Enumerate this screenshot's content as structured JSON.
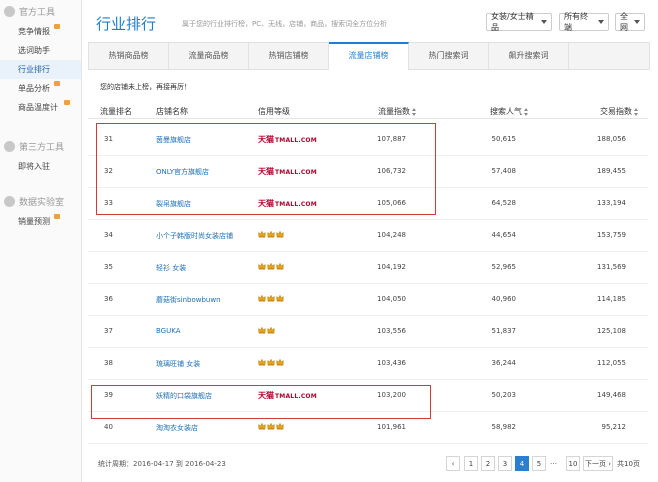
{
  "sidebar": {
    "sections": [
      {
        "title": "官方工具",
        "items": [
          {
            "label": "竞争情报",
            "flag": true
          },
          {
            "label": "选词助手",
            "flag": false
          },
          {
            "label": "行业排行",
            "flag": false,
            "active": true
          },
          {
            "label": "单品分析",
            "flag": true
          },
          {
            "label": "商品温度计",
            "flag": true
          }
        ]
      },
      {
        "title": "第三方工具",
        "items": [
          {
            "label": "即将入驻",
            "flag": false
          }
        ]
      },
      {
        "title": "数据实验室",
        "items": [
          {
            "label": "销量预测",
            "flag": true
          }
        ]
      }
    ]
  },
  "header": {
    "title": "行业排行",
    "desc": "属于您的行业排行榜，PC、无线，店铺，商品，搜索词全方位分析",
    "filters": [
      {
        "label": "女装/女士精品"
      },
      {
        "label": "所有终端"
      },
      {
        "label": "全网"
      }
    ]
  },
  "tabs": [
    {
      "label": "热销商品榜",
      "active": false
    },
    {
      "label": "流量商品榜",
      "active": false
    },
    {
      "label": "热销店铺榜",
      "active": false
    },
    {
      "label": "流量店铺榜",
      "active": true
    },
    {
      "label": "热门搜索词",
      "active": false
    },
    {
      "label": "飙升搜索词",
      "active": false
    }
  ],
  "notice": "您的店铺未上榜，再接再厉！",
  "table": {
    "columns": [
      "流量排名",
      "店铺名称",
      "信用等级",
      "流量指数",
      "搜索人气",
      "交易指数"
    ],
    "rows": [
      {
        "rank": "31",
        "shop": "茵曼旗舰店",
        "credit": "tmall",
        "crowns": 0,
        "flow": "107,887",
        "search": "50,615",
        "trade": "188,056"
      },
      {
        "rank": "32",
        "shop": "ONLY官方旗舰店",
        "credit": "tmall",
        "crowns": 0,
        "flow": "106,732",
        "search": "57,408",
        "trade": "189,455"
      },
      {
        "rank": "33",
        "shop": "裂帛旗舰店",
        "credit": "tmall",
        "crowns": 0,
        "flow": "105,066",
        "search": "64,528",
        "trade": "133,194"
      },
      {
        "rank": "34",
        "shop": "小个子韩版时尚女装店铺",
        "credit": "crown",
        "crowns": 3,
        "flow": "104,248",
        "search": "44,654",
        "trade": "153,759"
      },
      {
        "rank": "35",
        "shop": "轻衫 女装",
        "credit": "crown",
        "crowns": 3,
        "flow": "104,192",
        "search": "52,965",
        "trade": "131,569"
      },
      {
        "rank": "36",
        "shop": "蘑菇街sinbowbuwn",
        "credit": "crown",
        "crowns": 3,
        "flow": "104,050",
        "search": "40,960",
        "trade": "114,185"
      },
      {
        "rank": "37",
        "shop": "BGUKA",
        "credit": "crown",
        "crowns": 2,
        "flow": "103,556",
        "search": "51,837",
        "trade": "125,108"
      },
      {
        "rank": "38",
        "shop": "琉璃旺铺 女装",
        "credit": "crown",
        "crowns": 3,
        "flow": "103,436",
        "search": "36,244",
        "trade": "112,055"
      },
      {
        "rank": "39",
        "shop": "妖精的口袋旗舰店",
        "credit": "tmall",
        "crowns": 0,
        "flow": "103,200",
        "search": "50,203",
        "trade": "149,468"
      },
      {
        "rank": "40",
        "shop": "淘淘衣女装店",
        "credit": "crown",
        "crowns": 3,
        "flow": "101,961",
        "search": "58,982",
        "trade": "95,212"
      }
    ]
  },
  "tmall_logo": {
    "cn": "天猫",
    "en": "TMALL.COM"
  },
  "footer": {
    "period": "统计周期：2016-04-17 到 2016-04-23",
    "pages": [
      "‹",
      "1",
      "2",
      "3",
      "4",
      "5",
      "10",
      "下一页 ›"
    ],
    "active_page": "4",
    "ellipsis": "…",
    "total": "共10页"
  },
  "colors": {
    "accent": "#1f7ed0",
    "tmall": "#b0002a",
    "highlight": "#d23a3a",
    "crown": "#e3a21a"
  }
}
